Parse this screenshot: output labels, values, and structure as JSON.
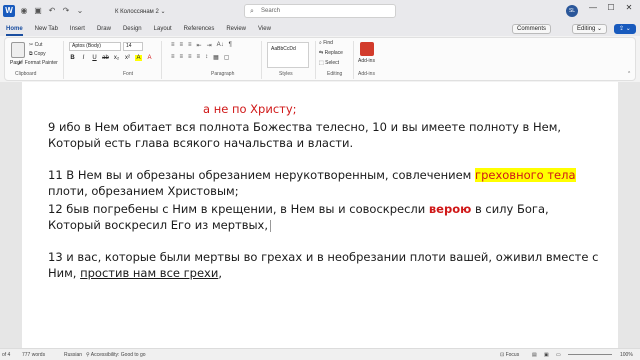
{
  "titlebar": {
    "autosave_icon": "autosave-icon",
    "doc_title": "К Колоссянам 2 ⌄",
    "search_placeholder": "Search",
    "avatar": "SL",
    "minimize": "—",
    "maximize": "☐",
    "close": "✕"
  },
  "tabs": [
    "Home",
    "New Tab",
    "Insert",
    "Draw",
    "Design",
    "Layout",
    "References",
    "Review",
    "View"
  ],
  "tab_right": {
    "comments": "Comments",
    "editing": "Editing ⌄",
    "share": "⇪ ⌄"
  },
  "ribbon": {
    "clipboard": {
      "paste": "Paste",
      "cut": "Cut",
      "copy": "Copy",
      "format_painter": "Format Painter",
      "label": "Clipboard"
    },
    "font": {
      "name": "Aptos (Body)",
      "size": "14",
      "label": "Font",
      "buttons": [
        "B",
        "I",
        "U",
        "ab",
        "x₂",
        "x²",
        "A",
        "A"
      ]
    },
    "paragraph": {
      "label": "Paragraph",
      "row1": [
        "≡",
        "≡",
        "≡",
        "⇤",
        "⇥",
        "A↓",
        "¶"
      ],
      "row2": [
        "≡",
        "≡",
        "≡",
        "≡",
        "↕",
        "▦",
        "▢"
      ]
    },
    "styles": {
      "normal": "AaBbCcDd",
      "label": "Styles"
    },
    "editing": {
      "find": "Find",
      "replace": "Replace",
      "select": "Select",
      "label": "Editing"
    },
    "addins": {
      "label": "Add-ins",
      "sub": "Add-ins"
    }
  },
  "document": {
    "line0": "а не по Христу;",
    "line1": "9 ибо в Нем обитает вся полнота Божества телесно, 10 и вы имеете полноту в Нем,",
    "line2": "Который есть глава всякого начальства и власти.",
    "line3_a": "11 В Нем вы и обрезаны обрезанием нерукотворенным, совлечением ",
    "line3_hl": "греховного тела",
    "line4": "плоти, обрезанием Христовым;",
    "line5_a": "12 быв погребены с Ним в крещении, в Нем вы и совоскресли ",
    "line5_b": "верою",
    "line5_c": " в силу Бога,",
    "line6": "Который воскресил Его из мертвых,",
    "line7": "13 и вас, которые были мертвы во грехах и в необрезании плоти вашей, оживил вместе с",
    "line8_a": "Ним, ",
    "line8_b": "простив нам все грехи",
    "line8_c": ","
  },
  "statusbar": {
    "page": "of 4",
    "words": "777 words",
    "lang": "Russian",
    "accessibility": "Accessibility: Good to go",
    "focus": "Focus",
    "zoom": "100%"
  }
}
